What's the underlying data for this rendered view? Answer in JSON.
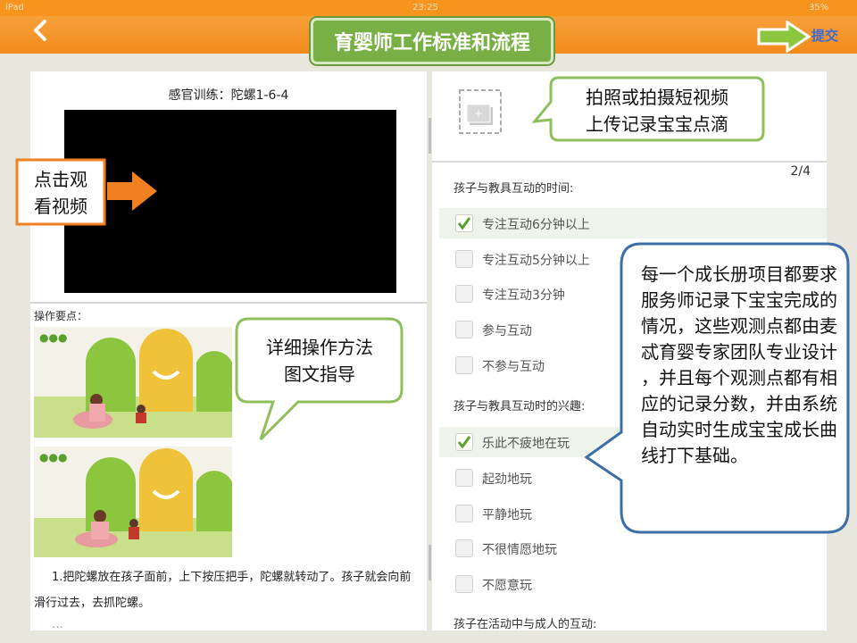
{
  "status": {
    "device": "iPad",
    "time": "23:25",
    "battery": "35%"
  },
  "header": {
    "title": "育婴师工作标准和流程",
    "submit_label": "提交"
  },
  "left": {
    "lesson_title": "感官训练：陀螺1-6-4",
    "ops_label": "操作要点：",
    "description": "1.把陀螺放在孩子面前，上下按压把手，陀螺就转动了。孩子就会向前滑行过去，去抓陀螺。",
    "description_cut": "…"
  },
  "right": {
    "page_indicator": "2/4",
    "questions": [
      {
        "label": "孩子与教具互动的时间:",
        "options": [
          {
            "label": "专注互动6分钟以上",
            "checked": true
          },
          {
            "label": "专注互动5分钟以上",
            "checked": false
          },
          {
            "label": "专注互动3分钟",
            "checked": false
          },
          {
            "label": "参与互动",
            "checked": false
          },
          {
            "label": "不参与互动",
            "checked": false
          }
        ]
      },
      {
        "label": "孩子与教具互动时的兴趣:",
        "options": [
          {
            "label": "乐此不疲地在玩",
            "checked": true
          },
          {
            "label": "起劲地玩",
            "checked": false
          },
          {
            "label": "平静地玩",
            "checked": false
          },
          {
            "label": "不很情愿地玩",
            "checked": false
          },
          {
            "label": "不愿意玩",
            "checked": false
          }
        ]
      },
      {
        "label": "孩子在活动中与成人的互动:"
      }
    ]
  },
  "callouts": {
    "video": "点击观\n看视频",
    "method": "详细操作方法\n图文指导",
    "photo": "拍照或拍摄短视频\n上传记录宝宝点滴",
    "explain": "每一个成长册项目都要求服务师记录下宝宝完成的情况，这些观测点都由麦忒育婴专家团队专业设计，并且每个观测点都有相应的记录分数，并由系统自动实时生成宝宝成长曲线打下基础。"
  },
  "colors": {
    "nav": "#f7941d",
    "title_green": "#79b045",
    "callout_border_green": "#8fbf5a",
    "callout_border_blue": "#3c6ea8",
    "arrow_orange": "#f08020"
  }
}
